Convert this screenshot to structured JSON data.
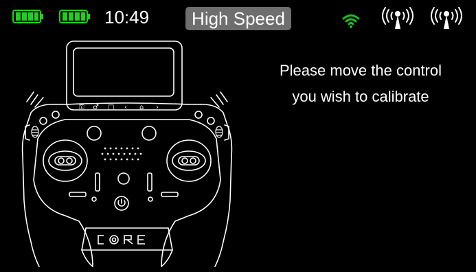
{
  "status_bar": {
    "time": "10:49",
    "mode": "High Speed",
    "batteries": [
      {
        "name": "transmitter-battery",
        "level": 1.0,
        "color": "#1fd11f"
      },
      {
        "name": "receiver-battery",
        "level": 1.0,
        "color": "#1fd11f"
      }
    ],
    "wifi": {
      "icon": "wifi-icon",
      "color": "#1fbf1f"
    },
    "antennas": [
      "antenna-icon",
      "antenna-icon"
    ]
  },
  "message": {
    "line1": "Please move the control",
    "line2": "you wish to calibrate"
  },
  "transmitter": {
    "logo": "C  RE",
    "icon": "transmitter-outline-icon"
  },
  "colors": {
    "background": "#000000",
    "accent_green": "#1fd11f",
    "pill": "#6e6e6e",
    "text": "#ffffff"
  }
}
